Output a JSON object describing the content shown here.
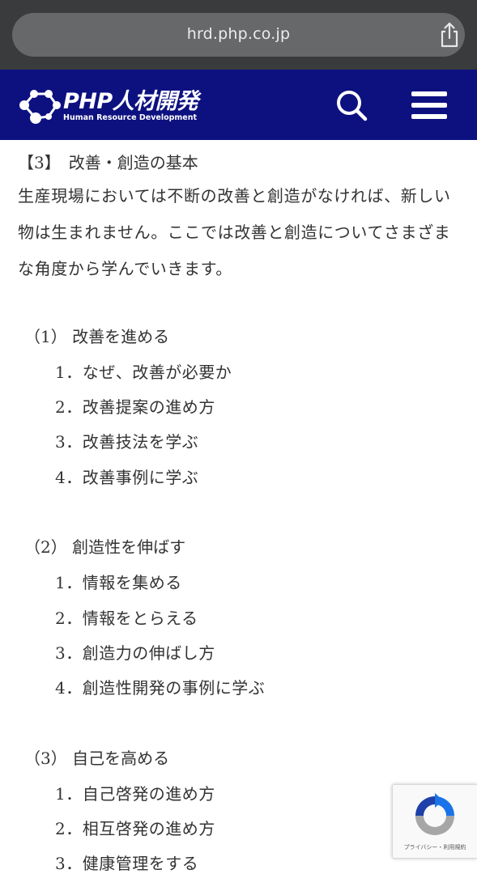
{
  "browser": {
    "url": "hrd.php.co.jp",
    "share_icon": "share-icon"
  },
  "header": {
    "logo_title": "PHP人材開発",
    "logo_subtitle": "Human Resource Development",
    "search_icon": "search-icon",
    "menu_icon": "hamburger-menu-icon",
    "background_color": "#0d1180"
  },
  "section": {
    "title": "【3】　改善・創造の基本",
    "intro": "生産現場においては不断の改善と創造がなければ、新しい物は生まれません。ここでは改善と創造についてさまざまな角度から学んでいきます。"
  },
  "groups": [
    {
      "heading": "（1） 改善を進める",
      "items": [
        "1．なぜ、改善が必要か",
        "2．改善提案の進め方",
        "3．改善技法を学ぶ",
        "4．改善事例に学ぶ"
      ]
    },
    {
      "heading": "（2） 創造性を伸ばす",
      "items": [
        "1．情報を集める",
        "2．情報をとらえる",
        "3．創造力の伸ばし方",
        "4．創造性開発の事例に学ぶ"
      ]
    },
    {
      "heading": "（3） 自己を高める",
      "items": [
        "1．自己啓発の進め方",
        "2．相互啓発の進め方",
        "3．健康管理をする"
      ]
    }
  ],
  "recaptcha": {
    "links": "プライバシー・利用規約",
    "icon": "recaptcha-icon"
  }
}
